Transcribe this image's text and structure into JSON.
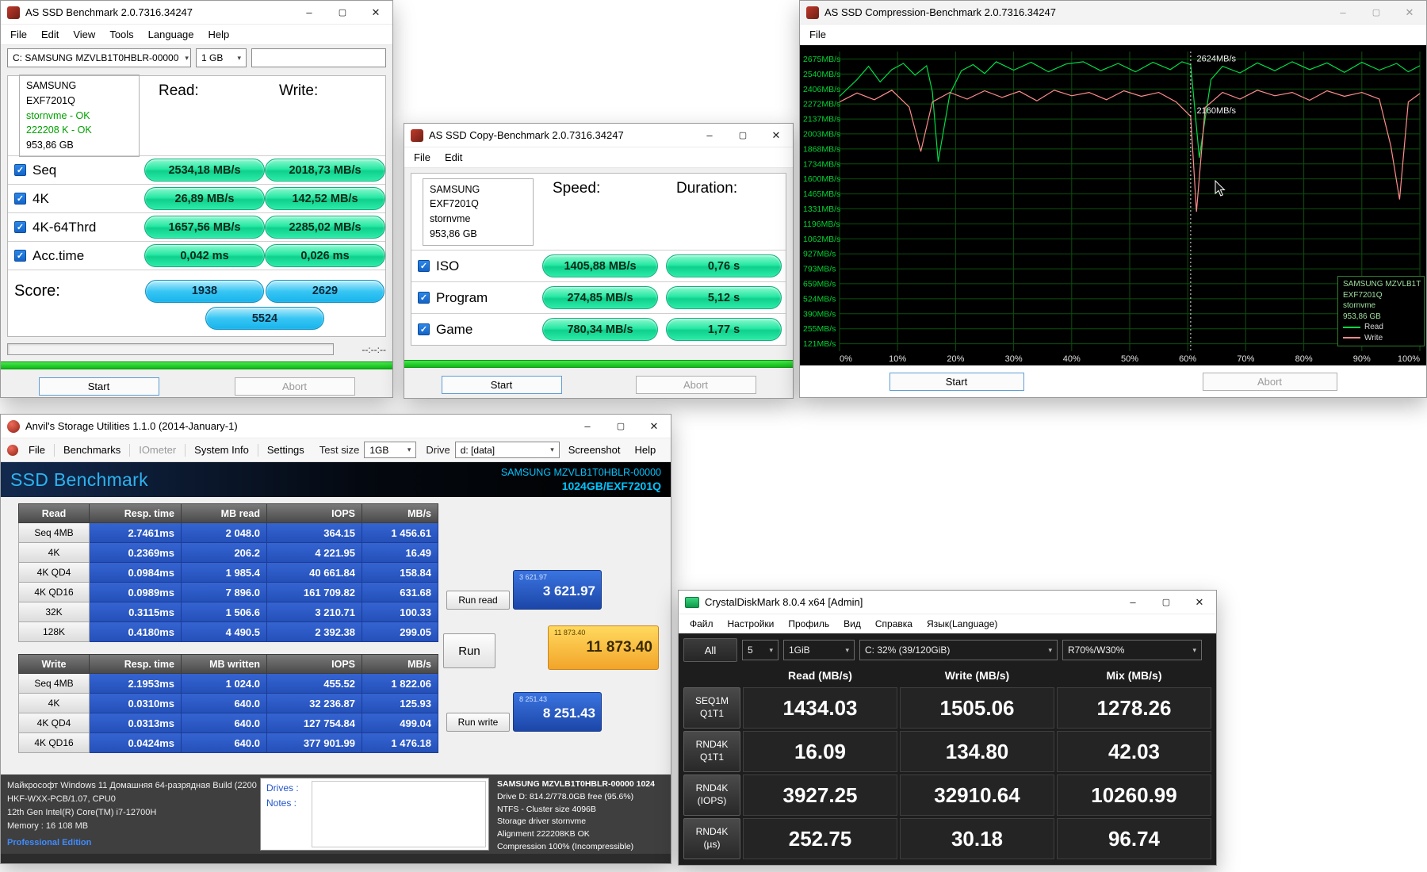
{
  "colors": {
    "pill_green": "#17dd96",
    "pill_blue": "#29c0f1",
    "anvil_blue": "#2c58c8",
    "anvil_orange": "#f5a623",
    "chart_read": "#00dc46",
    "chart_write": "#ff8c8c",
    "ok_green": "#00a000",
    "band_cyan": "#00c4ff"
  },
  "asssd": {
    "title": "AS SSD Benchmark 2.0.7316.34247",
    "menu": [
      "File",
      "Edit",
      "View",
      "Tools",
      "Language",
      "Help"
    ],
    "drive_select": "C: SAMSUNG MZVLB1T0HBLR-00000",
    "size_select": "1 GB",
    "drive_info": [
      "SAMSUNG",
      "EXF7201Q",
      "stornvme - OK",
      "222208 K - OK",
      "953,86 GB"
    ],
    "col_read": "Read:",
    "col_write": "Write:",
    "rows": [
      {
        "label": "Seq",
        "read": "2534,18 MB/s",
        "write": "2018,73 MB/s"
      },
      {
        "label": "4K",
        "read": "26,89 MB/s",
        "write": "142,52 MB/s"
      },
      {
        "label": "4K-64Thrd",
        "read": "1657,56 MB/s",
        "write": "2285,02 MB/s"
      },
      {
        "label": "Acc.time",
        "read": "0,042 ms",
        "write": "0,026 ms"
      }
    ],
    "score_label": "Score:",
    "score_read": "1938",
    "score_write": "2629",
    "score_total": "5524",
    "time_text": "--:--:--",
    "start": "Start",
    "abort": "Abort"
  },
  "copy": {
    "title": "AS SSD Copy-Benchmark 2.0.7316.34247",
    "menu": [
      "File",
      "Edit"
    ],
    "drive_info": [
      "SAMSUNG",
      "EXF7201Q",
      "stornvme",
      "953,86 GB"
    ],
    "col_speed": "Speed:",
    "col_duration": "Duration:",
    "rows": [
      {
        "label": "ISO",
        "speed": "1405,88 MB/s",
        "duration": "0,76 s"
      },
      {
        "label": "Program",
        "speed": "274,85 MB/s",
        "duration": "5,12 s"
      },
      {
        "label": "Game",
        "speed": "780,34 MB/s",
        "duration": "1,77 s"
      }
    ],
    "start": "Start",
    "abort": "Abort"
  },
  "comp": {
    "title": "AS SSD Compression-Benchmark 2.0.7316.34247",
    "menu": [
      "File"
    ],
    "start": "Start",
    "abort": "Abort"
  },
  "chart_data": {
    "type": "line",
    "title": "AS SSD Compression-Benchmark 2.0.7316.34247",
    "xticks": [
      "0%",
      "10%",
      "20%",
      "30%",
      "40%",
      "50%",
      "60%",
      "70%",
      "80%",
      "90%",
      "100%"
    ],
    "yticks": [
      2675,
      2540,
      2406,
      2272,
      2137,
      2003,
      1868,
      1734,
      1600,
      1465,
      1331,
      1196,
      1062,
      927,
      793,
      659,
      524,
      390,
      255,
      121
    ],
    "ytick_suffix": "MB/s",
    "ylim": [
      54,
      2742
    ],
    "grid": true,
    "legend_position": "right-bottom",
    "cursor_line_pct": 60.5,
    "annotations": [
      {
        "text": "2624MB/s",
        "x_pct": 61,
        "value": 2624
      },
      {
        "text": "2160MB/s",
        "x_pct": 61,
        "value": 2160
      }
    ],
    "legend_device": [
      "SAMSUNG MZVLB1T",
      "EXF7201Q",
      "stornvme",
      "953,86 GB"
    ],
    "series": [
      {
        "name": "Read",
        "color": "#00dc46",
        "points": [
          [
            0,
            2340
          ],
          [
            3,
            2490
          ],
          [
            5,
            2610
          ],
          [
            7,
            2470
          ],
          [
            9,
            2580
          ],
          [
            11,
            2635
          ],
          [
            13,
            2530
          ],
          [
            15,
            2615
          ],
          [
            16,
            2380
          ],
          [
            17,
            1755
          ],
          [
            19,
            2360
          ],
          [
            21,
            2570
          ],
          [
            23,
            2625
          ],
          [
            25,
            2545
          ],
          [
            27,
            2650
          ],
          [
            30,
            2575
          ],
          [
            33,
            2645
          ],
          [
            36,
            2560
          ],
          [
            39,
            2630
          ],
          [
            42,
            2650
          ],
          [
            45,
            2570
          ],
          [
            48,
            2635
          ],
          [
            51,
            2560
          ],
          [
            54,
            2645
          ],
          [
            57,
            2580
          ],
          [
            59,
            2650
          ],
          [
            60.5,
            2624
          ],
          [
            62,
            1790
          ],
          [
            64,
            2490
          ],
          [
            66,
            2610
          ],
          [
            69,
            2550
          ],
          [
            72,
            2640
          ],
          [
            75,
            2570
          ],
          [
            78,
            2650
          ],
          [
            81,
            2580
          ],
          [
            84,
            2640
          ],
          [
            87,
            2555
          ],
          [
            90,
            2645
          ],
          [
            93,
            2575
          ],
          [
            96,
            2635
          ],
          [
            98,
            2560
          ],
          [
            100,
            2615
          ]
        ]
      },
      {
        "name": "Write",
        "color": "#ff8c8c",
        "points": [
          [
            0,
            2290
          ],
          [
            3,
            2370
          ],
          [
            6,
            2310
          ],
          [
            9,
            2395
          ],
          [
            12,
            2245
          ],
          [
            14,
            1845
          ],
          [
            16,
            2290
          ],
          [
            19,
            2375
          ],
          [
            22,
            2315
          ],
          [
            25,
            2390
          ],
          [
            28,
            2330
          ],
          [
            31,
            2385
          ],
          [
            34,
            2300
          ],
          [
            37,
            2395
          ],
          [
            40,
            2345
          ],
          [
            43,
            2375
          ],
          [
            46,
            2310
          ],
          [
            49,
            2390
          ],
          [
            52,
            2340
          ],
          [
            55,
            2375
          ],
          [
            58,
            2290
          ],
          [
            60.5,
            2160
          ],
          [
            61.5,
            1305
          ],
          [
            63,
            2240
          ],
          [
            66,
            2375
          ],
          [
            69,
            2315
          ],
          [
            72,
            2395
          ],
          [
            75,
            2345
          ],
          [
            78,
            2375
          ],
          [
            81,
            2305
          ],
          [
            84,
            2390
          ],
          [
            87,
            2340
          ],
          [
            90,
            2375
          ],
          [
            93,
            2315
          ],
          [
            95,
            1895
          ],
          [
            96.5,
            1415
          ],
          [
            98,
            2290
          ],
          [
            100,
            2365
          ]
        ]
      }
    ]
  },
  "anvil": {
    "title": "Anvil's Storage Utilities 1.1.0 (2014-January-1)",
    "toolbar": [
      "File",
      "Benchmarks",
      "IOmeter",
      "System Info",
      "Settings"
    ],
    "test_size_label": "Test size",
    "test_size_value": "1GB",
    "drive_label": "Drive",
    "drive_value": "d: [data]",
    "toolbar_right": [
      "Screenshot",
      "Help"
    ],
    "band_title": "SSD Benchmark",
    "band_device": "SAMSUNG MZVLB1T0HBLR-00000",
    "band_device2": "1024GB/EXF7201Q",
    "read_table": {
      "headers": [
        "Read",
        "Resp. time",
        "MB read",
        "IOPS",
        "MB/s"
      ],
      "rows": [
        {
          "label": "Seq 4MB",
          "values": [
            "2.7461ms",
            "2 048.0",
            "364.15",
            "1 456.61"
          ]
        },
        {
          "label": "4K",
          "values": [
            "0.2369ms",
            "206.2",
            "4 221.95",
            "16.49"
          ]
        },
        {
          "label": "4K QD4",
          "values": [
            "0.0984ms",
            "1 985.4",
            "40 661.84",
            "158.84"
          ]
        },
        {
          "label": "4K QD16",
          "values": [
            "0.0989ms",
            "7 896.0",
            "161 709.82",
            "631.68"
          ]
        },
        {
          "label": "32K",
          "values": [
            "0.3115ms",
            "1 506.6",
            "3 210.71",
            "100.33"
          ]
        },
        {
          "label": "128K",
          "values": [
            "0.4180ms",
            "4 490.5",
            "2 392.38",
            "299.05"
          ]
        }
      ]
    },
    "write_table": {
      "headers": [
        "Write",
        "Resp. time",
        "MB written",
        "IOPS",
        "MB/s"
      ],
      "rows": [
        {
          "label": "Seq 4MB",
          "values": [
            "2.1953ms",
            "1 024.0",
            "455.52",
            "1 822.06"
          ]
        },
        {
          "label": "4K",
          "values": [
            "0.0310ms",
            "640.0",
            "32 236.87",
            "125.93"
          ]
        },
        {
          "label": "4K QD4",
          "values": [
            "0.0313ms",
            "640.0",
            "127 754.84",
            "499.04"
          ]
        },
        {
          "label": "4K QD16",
          "values": [
            "0.0424ms",
            "640.0",
            "377 901.99",
            "1 476.18"
          ]
        }
      ]
    },
    "run_read": "Run read",
    "run": "Run",
    "run_write": "Run write",
    "badge_read": {
      "small": "3 621.97",
      "large": "3 621.97"
    },
    "badge_total": {
      "small": "11 873.40",
      "large": "11 873.40"
    },
    "badge_write": {
      "small": "8 251.43",
      "large": "8 251.43"
    },
    "sys_lines": [
      "Майкрософт Windows 11 Домашняя 64-разрядная Build (2200",
      "HKF-WXX-PCB/1.07, CPU0",
      "12th Gen Intel(R) Core(TM) i7-12700H",
      "Memory : 16 108 MB"
    ],
    "edition": "Professional Edition",
    "drives_label": "Drives :",
    "notes_label": "Notes :",
    "disk_lines": [
      "SAMSUNG MZVLB1T0HBLR-00000 1024",
      "Drive D: 814.2/778.0GB free (95.6%)",
      "NTFS - Cluster size 4096B",
      "Storage driver stornvme",
      "Alignment 222208KB OK",
      "Compression 100% (Incompressible)"
    ]
  },
  "cdm": {
    "title": "CrystalDiskMark 8.0.4 x64 [Admin]",
    "menu": [
      "Файл",
      "Настройки",
      "Профиль",
      "Вид",
      "Справка",
      "Язык(Language)"
    ],
    "all_button": "All",
    "selects": [
      "5",
      "1GiB",
      "C: 32% (39/120GiB)",
      "R70%/W30%"
    ],
    "headers": [
      "Read (MB/s)",
      "Write (MB/s)",
      "Mix (MB/s)"
    ],
    "rows": [
      {
        "label": [
          "SEQ1M",
          "Q1T1"
        ],
        "values": [
          "1434.03",
          "1505.06",
          "1278.26"
        ]
      },
      {
        "label": [
          "RND4K",
          "Q1T1"
        ],
        "values": [
          "16.09",
          "134.80",
          "42.03"
        ]
      },
      {
        "label": [
          "RND4K",
          "(IOPS)"
        ],
        "values": [
          "3927.25",
          "32910.64",
          "10260.99"
        ]
      },
      {
        "label": [
          "RND4K",
          "(µs)"
        ],
        "values": [
          "252.75",
          "30.18",
          "96.74"
        ]
      }
    ]
  }
}
